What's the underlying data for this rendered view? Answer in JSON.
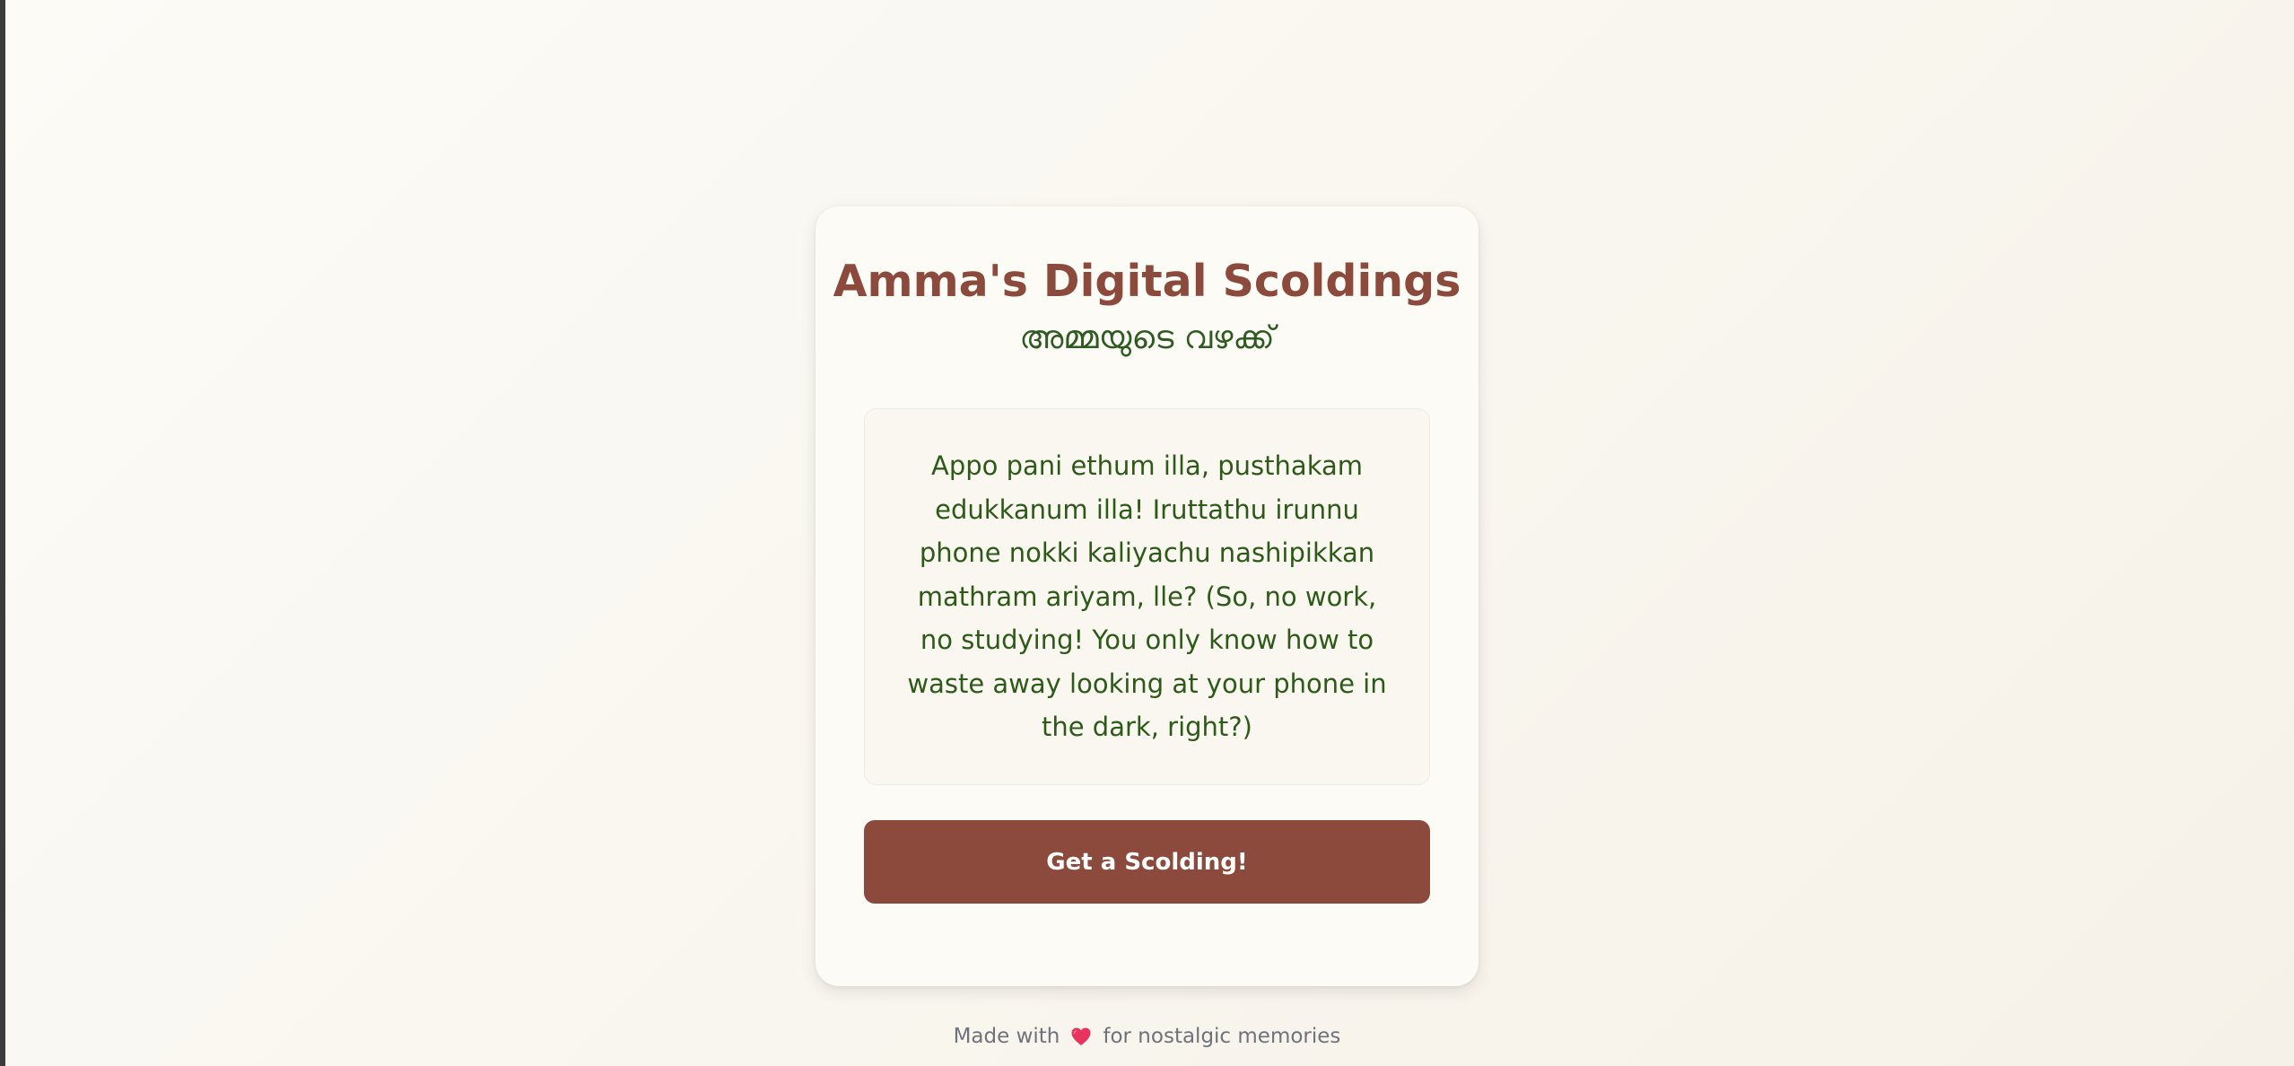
{
  "app": {
    "title": "Amma's Digital Scoldings",
    "subtitle": "അമ്മയുടെ വഴക്ക്"
  },
  "scolding": {
    "text": "Appo pani ethum illa, pusthakam edukkanum illa! Iruttathu irunnu phone nokki kaliyachu nashipikkan mathram ariyam, lle? (So, no work, no studying! You only know how to waste away looking at your phone in the dark, right?)"
  },
  "actions": {
    "get_scolding_label": "Get a Scolding!"
  },
  "footer": {
    "prefix": "Made with",
    "icon": "heart-icon",
    "suffix": "for nostalgic memories"
  },
  "colors": {
    "accent": "#8b4a3b",
    "text_green": "#2d5a18",
    "card_bg": "#fdfbf6",
    "page_bg": "#f9f6ef",
    "heart": "#e8335f",
    "footer_text": "#6f727a"
  }
}
